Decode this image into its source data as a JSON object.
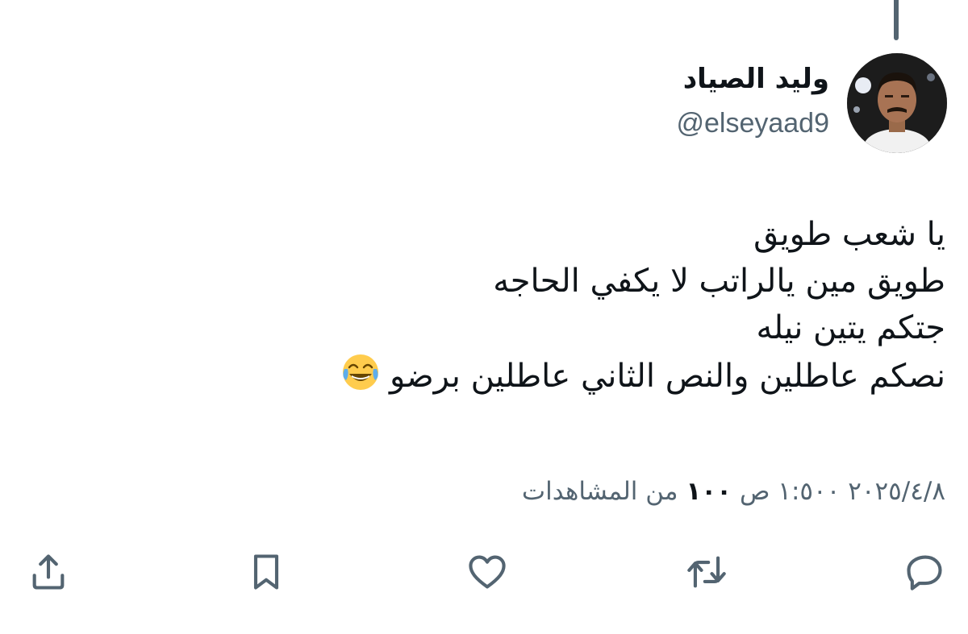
{
  "user": {
    "display_name": "وليد الصياد",
    "handle": "@elseyaad9"
  },
  "tweet": {
    "lines": [
      "يا شعب طويق",
      "طويق مين يالراتب لا يكفي الحاجه",
      "جتكم يتين نيله",
      "نصكم عاطلين والنص الثاني عاطلين برضو"
    ],
    "emoji": "😂"
  },
  "meta": {
    "date": "٢٠٢٥/٤/٨",
    "time": "١:٥٠٠",
    "period": "ص",
    "views_count": "١٠٠",
    "views_label": "من المشاهدات"
  },
  "actions": {
    "icons": [
      "reply-icon",
      "retweet-icon",
      "like-icon",
      "bookmark-icon",
      "share-icon"
    ],
    "icon_color": "#536471"
  }
}
